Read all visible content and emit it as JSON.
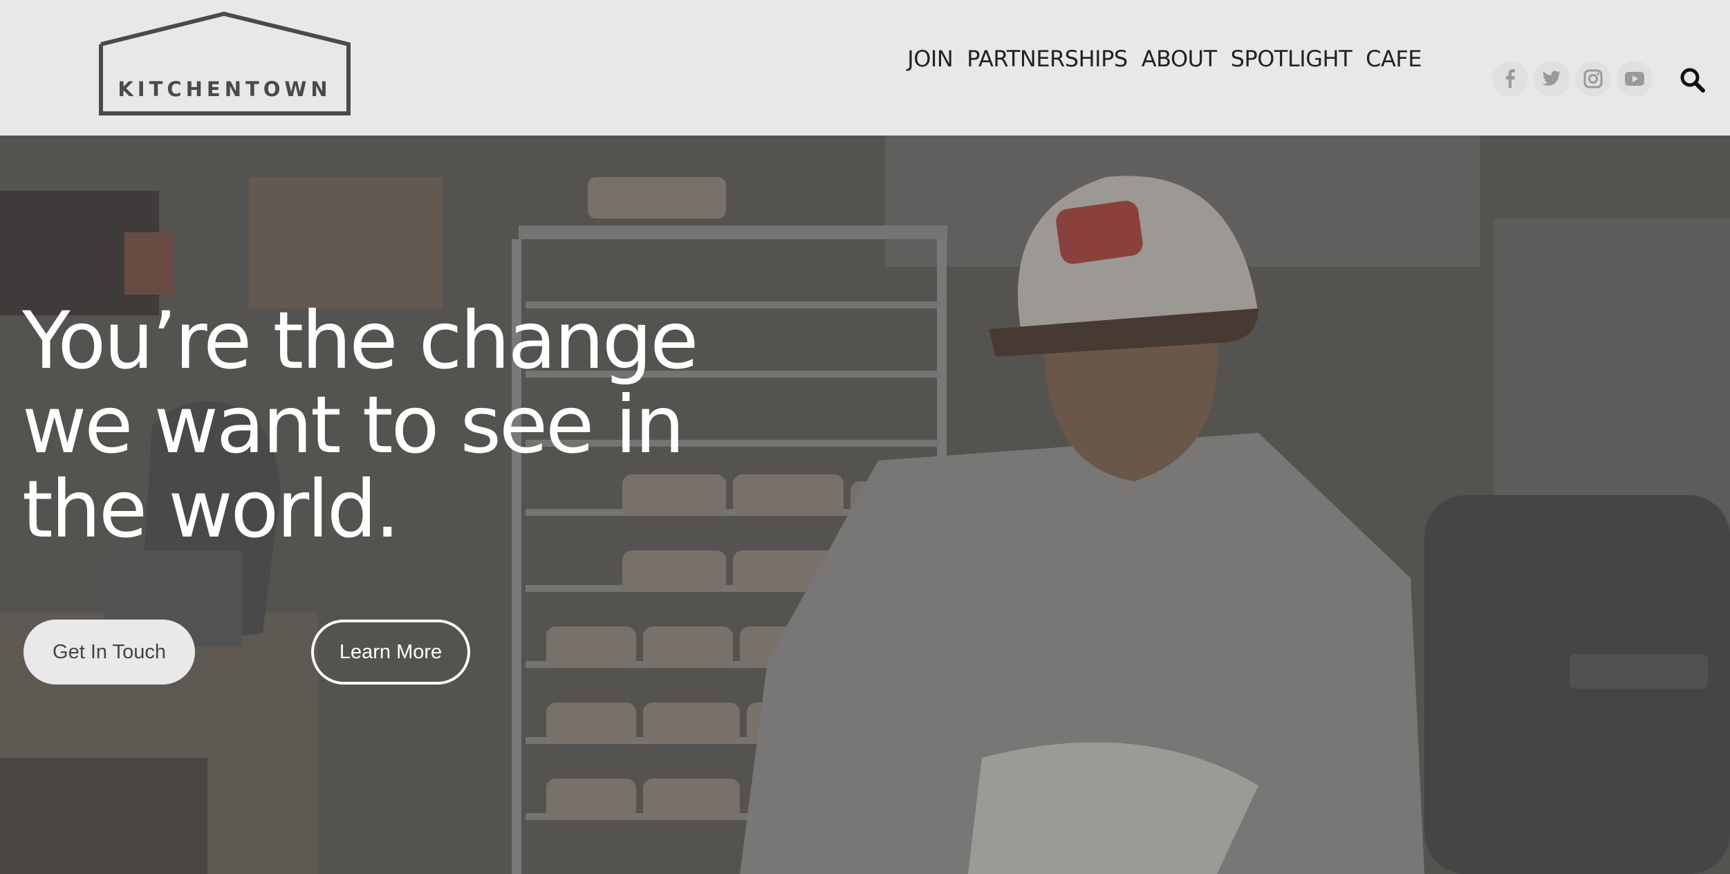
{
  "brand": {
    "logo_text": "KITCHENTOWN"
  },
  "nav": {
    "items": [
      "JOIN",
      "PARTNERSHIPS",
      "ABOUT",
      "SPOTLIGHT",
      "CAFE"
    ]
  },
  "social": {
    "icons": [
      "facebook-icon",
      "twitter-icon",
      "instagram-icon",
      "youtube-icon"
    ]
  },
  "hero": {
    "title": "You’re the change we want to see in the world.",
    "primary_button": "Get In Touch",
    "secondary_button": "Learn More"
  },
  "colors": {
    "header_bg": "#e8e8e8",
    "hero_overlay": "#5c5a57",
    "text_dark": "#222222",
    "text_light": "#ffffff"
  }
}
